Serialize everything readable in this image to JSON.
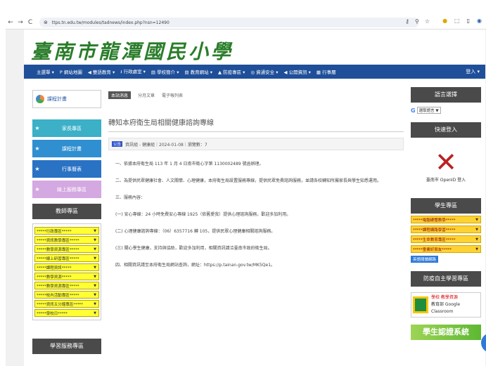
{
  "browser": {
    "url": "ttps.tn.edu.tw/modules/tadnews/index.php?nsn=12490"
  },
  "site": {
    "logo_text": "臺南市龍潭國民小學",
    "nav": [
      "主選單 ▾",
      "P 網站地圖",
      "◀ 雙語教育 ▾",
      "⭳ 行政處室 ▾",
      "▤ 學校簡介 ▾",
      "▤ 教育網站 ▾",
      "▲ 防疫專區 ▾",
      "◎ 資通安全 ▾",
      "◀ 公開資訊 ▾",
      "▦ 行事曆"
    ],
    "login": "登入 ▾"
  },
  "left": {
    "banner": "課程計畫",
    "menu": [
      {
        "label": "家長專區"
      },
      {
        "label": "課程計畫"
      },
      {
        "label": "行事曆表"
      },
      {
        "label": "線上服務專區"
      }
    ],
    "section_title": "教師專區",
    "selects": [
      "*****行政專區*****",
      "*****資訊教學專區*****",
      "*****教學資源專區*****",
      "*****線上研習專區*****",
      "*****課程資訊*****",
      "*****教學資源*****",
      "*****教學資源專區*****",
      "*****校內活動專區*****",
      "*****資訊五分鐘專區*****",
      "*****學校日*****"
    ],
    "section_title2": "學習服務專區"
  },
  "center": {
    "crumb": [
      "本站消息",
      "分月文章",
      "電子報列表"
    ],
    "title": "轉知本府衛生局相關健康諮詢專線",
    "meta_tag": "公告",
    "meta_text": "資訊組 - 健康組｜2024-01-08｜瀏覽數：7",
    "paragraphs": [
      "一、依據本府衛生局 113 年 1 月 4 日南市衛心字第 1130002489 號函辦理。",
      "二、為提供民眾健康社會、人文關懷、心理健康，本府衛生局設置服務專線，提供民眾免費諮詢服務，並請各校轉知所屬家長與學生知悉運用。",
      "三、服務內容：",
      "(一) 安心專線：24 小時免費安心專線 1925（依舊愛我）提供心理諮詢服務，歡迎多加利用。",
      "(二) 心理健康諮詢專線：（06）6357716 轉 105，提供民眾心理健康相關諮詢服務。",
      "(三) 關心學生健康，支持與協助，歡迎多加利用，相關資訊請洽臺南市政府衛生局。",
      "四、相關資訊請至本府衛生局網站查詢，網址：https://p.tainan.gov.tw/MK5Qe1。"
    ]
  },
  "right": {
    "lang_title": "語言選擇",
    "gtrans_label": "選取語言",
    "quick_title": "快速登入",
    "quick_caption": "臺南市 OpenID 登入",
    "student_title": "學生專區",
    "student_selects": [
      "*****電腦硬體教學*****",
      "*****課程網路學習*****",
      "*****生命教育專區*****",
      "*****童書好朋友*****"
    ],
    "student_button": "英語閱讀網路",
    "classroom_title": "防疫自主學習專區",
    "classroom_line1": "學校 教學資源",
    "classroom_line2": "教育部 Google",
    "classroom_line3": "Classroom",
    "banner": "學生認證系統"
  }
}
